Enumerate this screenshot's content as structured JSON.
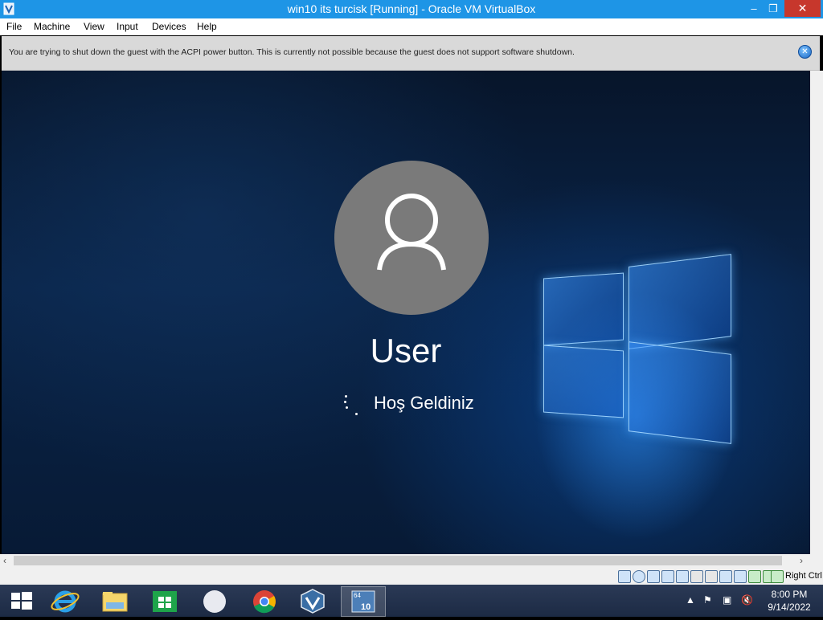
{
  "window": {
    "title": "win10 its turcisk [Running] - Oracle VM VirtualBox",
    "min": "–",
    "max": "❐",
    "close": "✕"
  },
  "menu": [
    "File",
    "Machine",
    "View",
    "Input",
    "Devices",
    "Help"
  ],
  "notice": {
    "message": "You are trying to shut down the guest with the ACPI power button. This is currently not possible because the guest does not support software shutdown."
  },
  "guest": {
    "username": "User",
    "welcome": "Hoş Geldiniz"
  },
  "statusbar": {
    "host_key": "Right Ctrl"
  },
  "taskbar": {
    "apps": [
      "start-button",
      "internet-explorer",
      "file-explorer",
      "store",
      "blank-app",
      "chrome",
      "virtualbox",
      "virtualbox-vm-win10"
    ],
    "vm_badge": "64",
    "vm_badge_num": "10",
    "time": "8:00 PM",
    "date": "9/14/2022"
  },
  "colors": {
    "titlebar": "#1e95e6",
    "close": "#c7372c",
    "taskbar": "#1c2a44",
    "avatar": "#7a7a7a"
  }
}
